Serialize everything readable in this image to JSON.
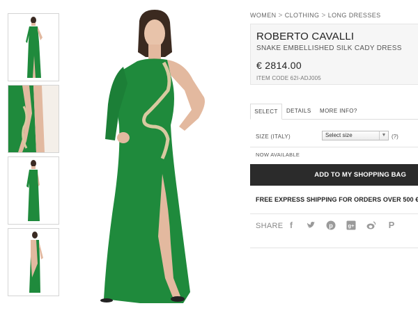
{
  "breadcrumb": {
    "items": [
      "WOMEN",
      "CLOTHING",
      "LONG DRESSES"
    ],
    "separator": ">"
  },
  "product": {
    "brand": "ROBERTO CAVALLI",
    "description": "SNAKE EMBELLISHED SILK CADY DRESS",
    "price": "€ 2814.00",
    "item_code": "ITEM CODE 62I-ADJ005"
  },
  "tabs": [
    {
      "label": "SELECT",
      "active": true
    },
    {
      "label": "DETAILS",
      "active": false
    },
    {
      "label": "MORE INFO?",
      "active": false
    }
  ],
  "size": {
    "label": "SIZE (ITALY)",
    "selected": "Select size",
    "help": "(?)"
  },
  "availability": "NOW AVAILABLE",
  "add_to_bag": "ADD TO MY SHOPPING BAG",
  "shipping": "FREE EXPRESS SHIPPING FOR ORDERS OVER 500 €",
  "share": {
    "label": "SHARE",
    "icons": [
      "facebook-icon",
      "twitter-icon",
      "pinterest-icon",
      "google-plus-icon",
      "weibo-icon",
      "p-icon"
    ]
  },
  "colors": {
    "dress_green": "#1f8a3c",
    "button_dark": "#2b2b2b",
    "panel_bg": "#f6f6f6"
  }
}
